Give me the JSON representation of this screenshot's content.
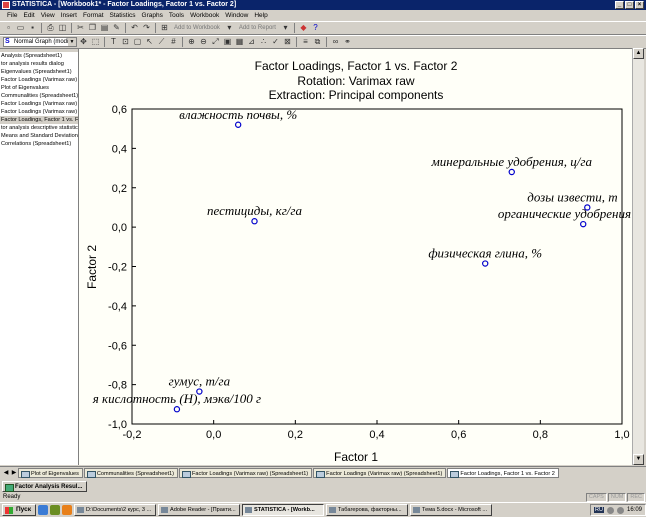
{
  "window": {
    "title": "STATISTICA - [Workbook1* - Factor Loadings, Factor 1 vs. Factor 2]",
    "controls": {
      "minimize": "_",
      "maximize": "□",
      "close": "×"
    }
  },
  "menu": [
    "File",
    "Edit",
    "View",
    "Insert",
    "Format",
    "Statistics",
    "Graphs",
    "Tools",
    "Workbook",
    "Window",
    "Help"
  ],
  "toolbar": {
    "add_to_workbook": "Add to Workbook",
    "add_to_report": "Add to Report",
    "graph_type": "Normal Graph (modi..."
  },
  "sidebar": {
    "items": [
      "Analysis (Spreadsheet1)",
      "tor analysis results dialog",
      "Eigenvalues (Spreadsheet1)",
      "Factor Loadings (Varimax raw)",
      "Plot of Eigenvalues",
      "Communalities (Spreadsheet1)",
      "Factor Loadings (Varimax raw)",
      "Factor Loadings (Varimax raw)",
      "Factor Loadings, Factor 1 vs. F",
      "tor analysis descriptive statistic",
      "Means and Standard Deviation",
      "Correlations (Spreadsheet1)"
    ],
    "selected_index": 8
  },
  "tabs": [
    "Plot of Eigenvalues",
    "Communalities (Spreadsheet1)",
    "Factor Loadings (Varimax raw) (Spreadsheet1)",
    "Factor Loadings (Varimax raw) (Spreadsheet1)",
    "Factor Loadings, Factor 1 vs. Factor 2"
  ],
  "active_tab_index": 4,
  "output_button": "Factor Analysis Resul...",
  "status": {
    "text": "Ready",
    "indicators": [
      "CAPS",
      "NUM",
      "REC"
    ]
  },
  "taskbar": {
    "start": "Пуск",
    "tasks": [
      "D:\\Documents\\2 курс, 3 ...",
      "Adobe Reader - [Практи...",
      "STATISTICA - [Workb...",
      "Табагерова, факторны...",
      "Тема 5.docx - Microsoft ..."
    ],
    "active_task_index": 2,
    "lang": "RU",
    "clock": "16:09"
  },
  "colors": {
    "point_stroke": "#0000cc",
    "plot_bg": "#fffff8",
    "title_bar": "#0a246a"
  },
  "chart_data": {
    "type": "scatter",
    "title": "Factor Loadings, Factor 1 vs. Factor 2",
    "subtitle_lines": [
      "Rotation: Varimax raw",
      "Extraction: Principal components"
    ],
    "xlabel": "Factor 1",
    "ylabel": "Factor 2",
    "xlim": [
      -0.2,
      1.0
    ],
    "ylim": [
      -1.0,
      0.6
    ],
    "xticks": [
      "-0,2",
      "0,0",
      "0,2",
      "0,4",
      "0,6",
      "0,8",
      "1,0"
    ],
    "yticks": [
      "0,6",
      "0,4",
      "0,2",
      "0,0",
      "-0,2",
      "-0,4",
      "-0,6",
      "-0,8",
      "-1,0"
    ],
    "grid": false,
    "points": [
      {
        "label": "влажность почвы, %",
        "x": 0.06,
        "y": 0.52
      },
      {
        "label": "минеральные удобрения, ц/га",
        "x": 0.73,
        "y": 0.28
      },
      {
        "label": "дозы извести, т",
        "x": 0.915,
        "y": 0.1
      },
      {
        "label": "органические удобрения",
        "x": 0.905,
        "y": 0.015
      },
      {
        "label": "пестициды, кг/га",
        "x": 0.1,
        "y": 0.03
      },
      {
        "label": "физическая глина, %",
        "x": 0.665,
        "y": -0.185
      },
      {
        "label": "гумус, т/га",
        "x": -0.035,
        "y": -0.835
      },
      {
        "label": "я кислотность (Н), мэкв/100 г",
        "x": -0.09,
        "y": -0.925
      }
    ]
  }
}
